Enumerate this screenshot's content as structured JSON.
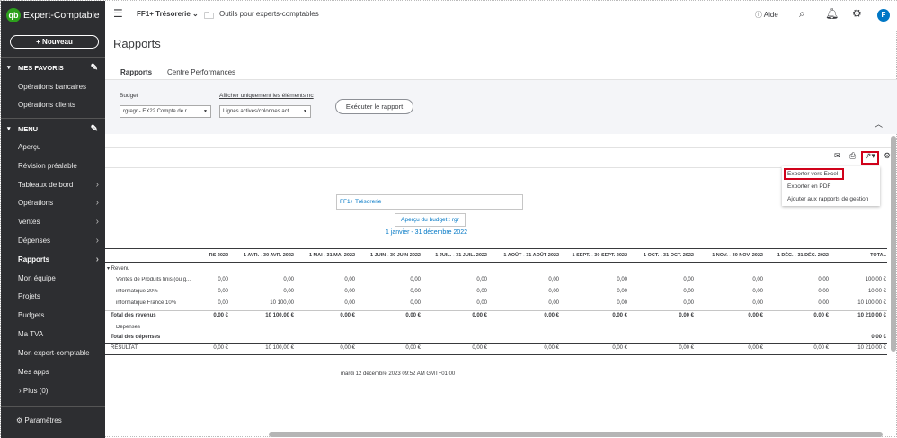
{
  "app": {
    "title": "Expert-Comptable",
    "new_button": "+ Nouveau"
  },
  "sidebar": {
    "favorites_header": "MES FAVORIS",
    "favorites": [
      "Opérations bancaires",
      "Opérations clients"
    ],
    "menu_header": "MENU",
    "menu": [
      {
        "label": "Aperçu",
        "arrow": false
      },
      {
        "label": "Révision préalable",
        "arrow": false
      },
      {
        "label": "Tableaux de bord",
        "arrow": true
      },
      {
        "label": "Opérations",
        "arrow": true
      },
      {
        "label": "Ventes",
        "arrow": true
      },
      {
        "label": "Dépenses",
        "arrow": true
      },
      {
        "label": "Rapports",
        "arrow": true,
        "active": true
      },
      {
        "label": "Mon équipe",
        "arrow": false
      },
      {
        "label": "Projets",
        "arrow": false
      },
      {
        "label": "Budgets",
        "arrow": false
      },
      {
        "label": "Ma TVA",
        "arrow": false
      },
      {
        "label": "Mon expert-comptable",
        "arrow": false
      },
      {
        "label": "Mes apps",
        "arrow": false
      }
    ],
    "plus": "Plus (0)",
    "settings": "Paramètres"
  },
  "topbar": {
    "company": "FF1+ Trésorerie",
    "tools": "Outils pour experts-comptables",
    "help": "Aide",
    "avatar": "F"
  },
  "page": {
    "title": "Rapports",
    "tabs": [
      "Rapports",
      "Centre Performances"
    ]
  },
  "filters": {
    "budget_label": "Budget",
    "budget_value": "rgregr - EX22 Compte de r",
    "show_label": "Afficher uniquement les éléments nc",
    "show_value": "Lignes actives/colonnes act",
    "run_button": "Exécuter le rapport"
  },
  "export_menu": [
    "Exporter vers Excel",
    "Exporter en PDF",
    "Ajouter aux rapports de gestion"
  ],
  "report": {
    "company": "FF1+ Trésorerie",
    "subtitle": "Aperçu du budget : rgr",
    "period": "1 janvier - 31 décembre 2022",
    "columns": [
      "RS 2022",
      "1 AVR. - 30 AVR. 2022",
      "1 MAI - 31 MAI 2022",
      "1 JUIN - 30 JUIN 2022",
      "1 JUIL. - 31 JUIL. 2022",
      "1 AOÛT - 31 AOÛT 2022",
      "1 SEPT. - 30 SEPT. 2022",
      "1 OCT. - 31 OCT. 2022",
      "1 NOV. - 30 NOV. 2022",
      "1 DÉC. - 31 DÉC. 2022",
      "TOTAL"
    ],
    "rows": [
      {
        "label": "▾ Revenu",
        "indent": 0,
        "bold": false,
        "values": []
      },
      {
        "label": "Ventes de Produits finis (ou g...",
        "indent": 2,
        "bold": false,
        "values": [
          "0,00",
          "0,00",
          "0,00",
          "0,00",
          "0,00",
          "0,00",
          "0,00",
          "0,00",
          "0,00",
          "0,00",
          "100,00 €"
        ]
      },
      {
        "label": "informatique 20%",
        "indent": 2,
        "bold": false,
        "values": [
          "0,00",
          "0,00",
          "0,00",
          "0,00",
          "0,00",
          "0,00",
          "0,00",
          "0,00",
          "0,00",
          "0,00",
          "10,00 €"
        ]
      },
      {
        "label": "informatique France 10%",
        "indent": 2,
        "bold": false,
        "values": [
          "0,00",
          "10 100,00",
          "0,00",
          "0,00",
          "0,00",
          "0,00",
          "0,00",
          "0,00",
          "0,00",
          "0,00",
          "10 100,00 €"
        ]
      },
      {
        "label": "Total des revenus",
        "indent": 1,
        "bold": true,
        "values": [
          "0,00 €",
          "10 100,00 €",
          "0,00 €",
          "0,00 €",
          "0,00 €",
          "0,00 €",
          "0,00 €",
          "0,00 €",
          "0,00 €",
          "0,00 €",
          "10 210,00 €"
        ],
        "topline": true
      },
      {
        "label": "Dépenses",
        "indent": 2,
        "bold": false,
        "values": []
      },
      {
        "label": "Total des dépenses",
        "indent": 1,
        "bold": true,
        "values": [
          "",
          "",
          "",
          "",
          "",
          "",
          "",
          "",
          "",
          "",
          "0,00 €"
        ]
      },
      {
        "label": "RÉSULTAT",
        "indent": 1,
        "bold": false,
        "values": [
          "0,00 €",
          "10 100,00 €",
          "0,00 €",
          "0,00 €",
          "0,00 €",
          "0,00 €",
          "0,00 €",
          "0,00 €",
          "0,00 €",
          "0,00 €",
          "10 210,00 €"
        ],
        "topline": true
      }
    ],
    "footer": "mardi 12 décembre 2023   09:52 AM GMT+01:00"
  }
}
